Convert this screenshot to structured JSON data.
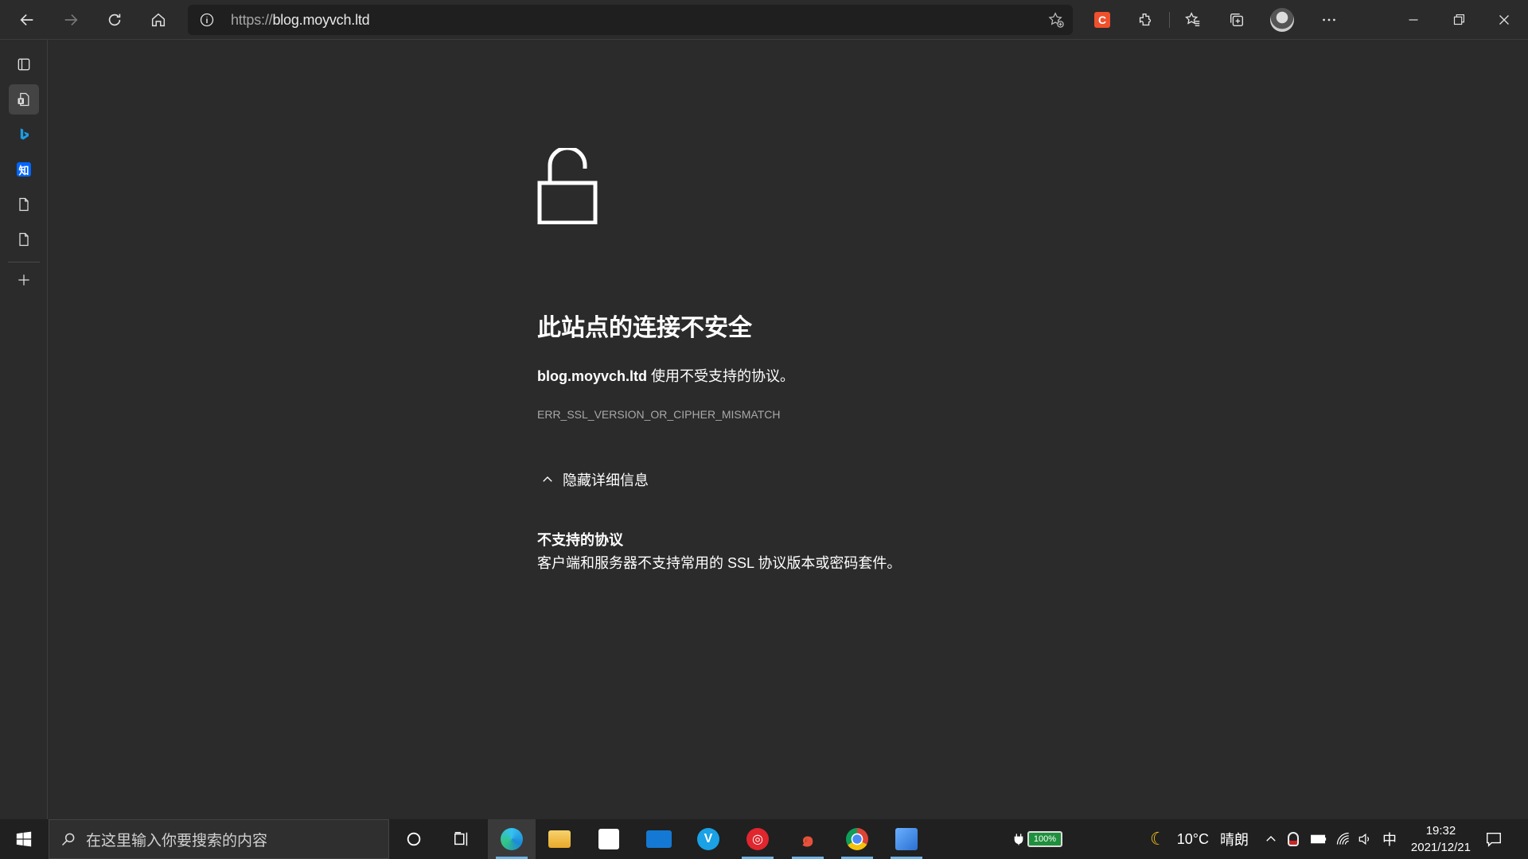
{
  "browser": {
    "url_protocol": "https://",
    "url_host": "blog.moyvch.ltd"
  },
  "error_page": {
    "title": "此站点的连接不安全",
    "host": "blog.moyvch.ltd",
    "description_suffix": " 使用不受支持的协议。",
    "error_code": "ERR_SSL_VERSION_OR_CIPHER_MISMATCH",
    "toggle_label": "隐藏详细信息",
    "detail_title": "不支持的协议",
    "detail_text": "客户端和服务器不支持常用的 SSL 协议版本或密码套件。"
  },
  "sidebar": {
    "items": [
      "tabs-icon",
      "office-icon",
      "bing-icon",
      "zhihu-icon",
      "document-icon",
      "document-icon",
      "add-icon"
    ],
    "zhihu_label": "知"
  },
  "taskbar": {
    "search_placeholder": "在这里输入你要搜索的内容",
    "battery_label": "100%",
    "weather_temp": "10°C",
    "weather_desc": "晴朗",
    "ime": "中",
    "time": "19:32",
    "date": "2021/12/21"
  },
  "colors": {
    "background": "#2b2b2b",
    "taskbar": "#202020",
    "accent": "#0078d4"
  }
}
